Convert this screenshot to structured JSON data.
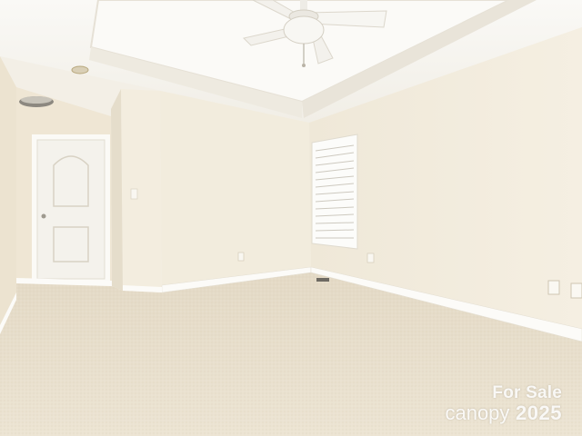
{
  "watermark": {
    "line1": "For Sale",
    "brand": "canopy",
    "year": "2025"
  },
  "colors": {
    "wall": "#f1ebdc",
    "wall_shadow": "#e9e2d1",
    "ceiling": "#f7f5f0",
    "carpet": "#e6ddca",
    "trim": "#fbfaf6",
    "door": "#f4f2ec"
  },
  "icons": {
    "fan": "ceiling-fan-icon",
    "light": "ceiling-light-icon"
  }
}
